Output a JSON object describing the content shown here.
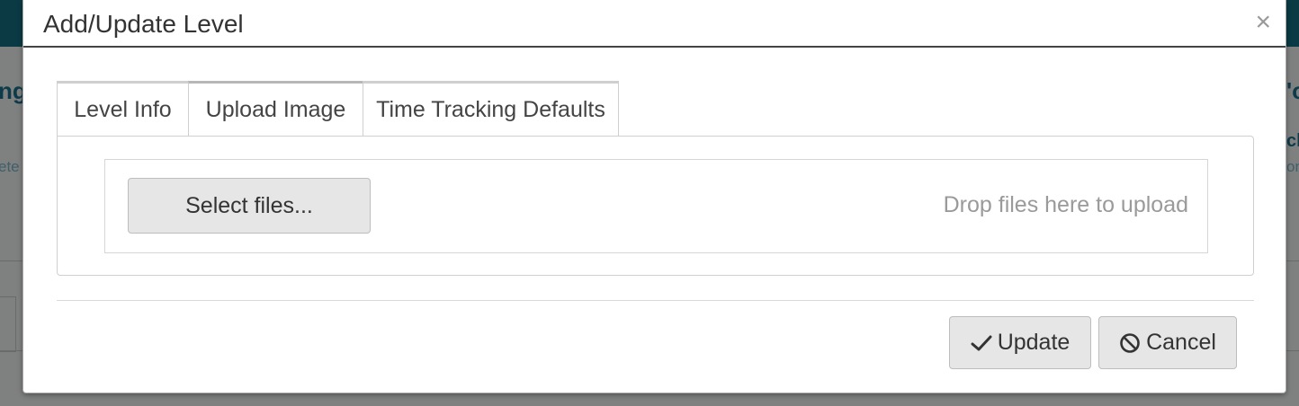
{
  "dialog": {
    "title": "Add/Update Level",
    "close_symbol": "×"
  },
  "tabs": [
    {
      "label": "Level Info"
    },
    {
      "label": "Upload Image",
      "active": true
    },
    {
      "label": "Time Tracking Defaults"
    }
  ],
  "upload": {
    "select_label": "Select files...",
    "drop_hint": "Drop files here to upload"
  },
  "footer": {
    "update_label": "Update",
    "update_icon": "check-icon",
    "cancel_label": "Cancel",
    "cancel_icon": "ban-icon"
  },
  "background": {
    "left_heading": "ng",
    "left_sub": "ete",
    "right_heading": "'o",
    "right_heading2": "cl",
    "right_sub": "on"
  },
  "colors": {
    "overlay": "#7d7d7d",
    "topbar": "#0b3a44",
    "button_bg": "#e6e6e6",
    "hint_text": "#9a9a9a"
  }
}
